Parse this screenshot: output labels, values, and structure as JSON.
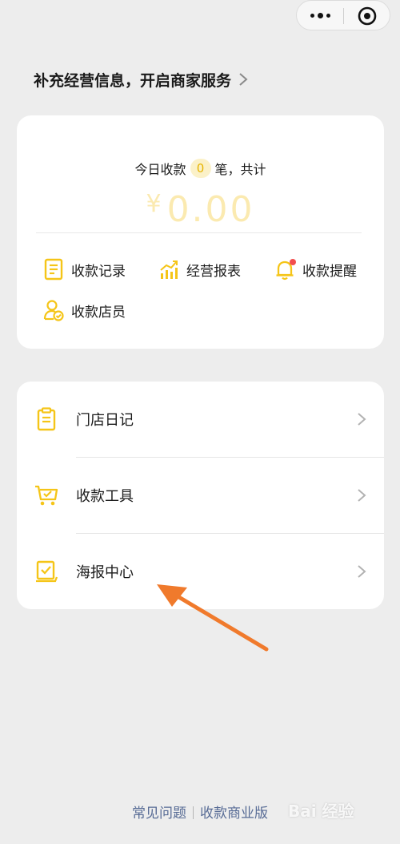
{
  "header": {
    "title": "补充经营信息，开启商家服务"
  },
  "summary": {
    "today_prefix": "今日收款",
    "count": "0",
    "today_suffix": "笔，共计",
    "currency": "¥",
    "amount": "0.00"
  },
  "quick_actions": [
    {
      "label": "收款记录",
      "icon": "receipt-icon"
    },
    {
      "label": "经营报表",
      "icon": "chart-icon"
    },
    {
      "label": "收款提醒",
      "icon": "bell-icon"
    },
    {
      "label": "收款店员",
      "icon": "clerk-icon"
    }
  ],
  "menu": [
    {
      "label": "门店日记",
      "icon": "clipboard-icon"
    },
    {
      "label": "收款工具",
      "icon": "cart-icon"
    },
    {
      "label": "海报中心",
      "icon": "poster-icon"
    }
  ],
  "footer": {
    "faq": "常见问题",
    "business": "收款商业版"
  },
  "watermark": "Bai 经验",
  "colors": {
    "accent": "#f5c518",
    "amount": "#fbeab0",
    "link": "#576b95",
    "annotation_arrow": "#f07a2c",
    "notify_dot": "#f24e4e"
  }
}
